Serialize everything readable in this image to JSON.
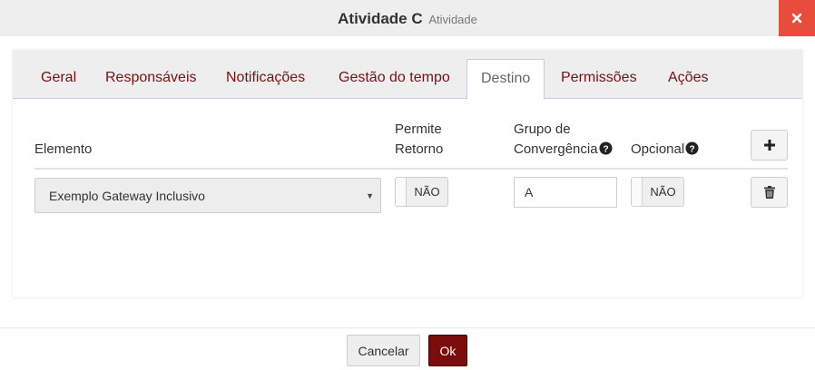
{
  "dialog": {
    "title": "Atividade C",
    "subtitle": "Atividade",
    "close_icon": "close-icon"
  },
  "tabs": [
    {
      "label": "Geral",
      "active": false
    },
    {
      "label": "Responsáveis",
      "active": false
    },
    {
      "label": "Notificações",
      "active": false
    },
    {
      "label": "Gestão do tempo",
      "active": false
    },
    {
      "label": "Destino",
      "active": true
    },
    {
      "label": "Permissões",
      "active": false
    },
    {
      "label": "Ações",
      "active": false
    }
  ],
  "table": {
    "headers": {
      "elemento": "Elemento",
      "permite_retorno_line1": "Permite",
      "permite_retorno_line2": "Retorno",
      "grupo_line1": "Grupo de",
      "grupo_line2": "Convergência",
      "opcional": "Opcional"
    },
    "rows": [
      {
        "elemento": "Exemplo Gateway Inclusivo",
        "permite_retorno": "NÃO",
        "grupo_convergencia": "A",
        "opcional": "NÃO"
      }
    ]
  },
  "icons": {
    "help": "question-circle-icon",
    "add": "plus-icon",
    "delete": "trash-icon",
    "caret": "caret-down-icon"
  },
  "colors": {
    "accent": "#7a0c0c",
    "close": "#e74c3c",
    "tab_text": "#7b1010"
  },
  "footer": {
    "cancel_label": "Cancelar",
    "ok_label": "Ok"
  }
}
